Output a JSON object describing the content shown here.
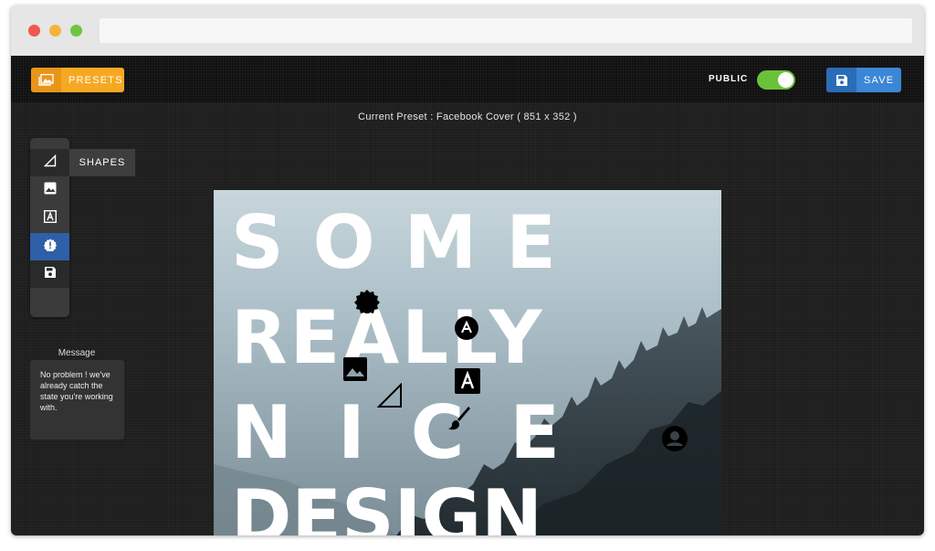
{
  "toolbar": {
    "presets_label": "PRESETS",
    "public_label": "PUBLIC",
    "save_label": "SAVE",
    "public_enabled": true
  },
  "preset_info": "Current Preset : Facebook Cover ( 851 x 352 )",
  "side_tools": {
    "items": [
      "shape-tool",
      "image-tool",
      "text-tool",
      "badge-tool",
      "save-tool"
    ],
    "active": "badge-tool",
    "tooltip": "SHAPES"
  },
  "message": {
    "title": "Message",
    "body": "No problem ! we've already catch the state you're working with."
  },
  "canvas_text": {
    "line1": "SOME",
    "line2": "REALLY",
    "line3": "NICE",
    "line4": "DESIGN"
  },
  "colors": {
    "presets": "#f7a823",
    "save": "#3c86d6",
    "toggle_on": "#6ac23a",
    "active_tool": "#2e5fa7"
  }
}
